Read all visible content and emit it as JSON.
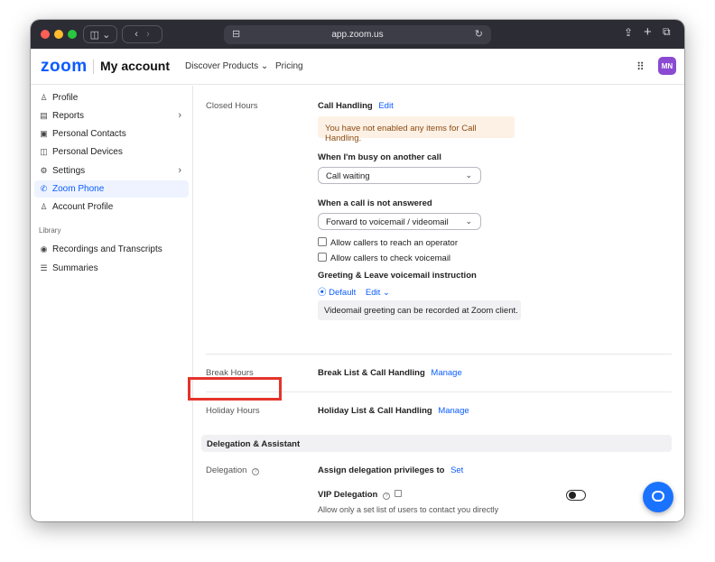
{
  "browser": {
    "url": "app.zoom.us",
    "traffic_colors": [
      "#ff5f57",
      "#febc2e",
      "#28c840"
    ]
  },
  "header": {
    "logo": "zoom",
    "title": "My account",
    "nav": [
      "Discover Products",
      "Pricing"
    ],
    "discover_caret": "⌄",
    "avatar_initials": "MN",
    "apps_glyph": "⠿"
  },
  "sidebar": {
    "items": [
      {
        "label": "Profile",
        "icon": "person-icon",
        "glyph": "♙",
        "chevron": false
      },
      {
        "label": "Reports",
        "icon": "report-icon",
        "glyph": "▤",
        "chevron": true
      },
      {
        "label": "Personal Contacts",
        "icon": "contacts-icon",
        "glyph": "▣",
        "chevron": false
      },
      {
        "label": "Personal Devices",
        "icon": "devices-icon",
        "glyph": "◫",
        "chevron": false
      },
      {
        "label": "Settings",
        "icon": "gear-icon",
        "glyph": "⚙",
        "chevron": true
      },
      {
        "label": "Zoom Phone",
        "icon": "phone-icon",
        "glyph": "✆",
        "chevron": false,
        "active": true
      },
      {
        "label": "Account Profile",
        "icon": "account-profile-icon",
        "glyph": "♙",
        "chevron": false
      }
    ],
    "library_label": "Library",
    "library_items": [
      {
        "label": "Recordings and Transcripts",
        "icon": "recording-icon",
        "glyph": "◉"
      },
      {
        "label": "Summaries",
        "icon": "summaries-icon",
        "glyph": "☰"
      }
    ]
  },
  "main": {
    "closed_hours": {
      "label": "Closed Hours",
      "call_handling": "Call Handling",
      "edit": "Edit",
      "alert": "You have not enabled any items for Call Handling.",
      "busy_title": "When I'm busy on another call",
      "busy_value": "Call waiting",
      "unanswered_title": "When a call is not answered",
      "unanswered_value": "Forward to voicemail / videomail",
      "opt_operator": "Allow callers to reach an operator",
      "opt_voicemail": "Allow callers to check voicemail",
      "greeting_title": "Greeting & Leave voicemail instruction",
      "greeting_default": "⦿ Default",
      "greeting_edit": "Edit ⌄",
      "info": "Videomail greeting can be recorded at Zoom client."
    },
    "break_hours": {
      "label": "Break Hours",
      "text": "Break List & Call Handling",
      "manage": "Manage"
    },
    "holiday_hours": {
      "label": "Holiday Hours",
      "text": "Holiday List & Call Handling",
      "manage": "Manage"
    },
    "delegation_section": "Delegation & Assistant",
    "delegation": {
      "label": "Delegation",
      "assign": "Assign delegation privileges to",
      "set": "Set",
      "vip_title": "VIP Delegation",
      "vip_desc": "Allow only a set list of users to contact you directly",
      "vip_enabled": false
    }
  }
}
